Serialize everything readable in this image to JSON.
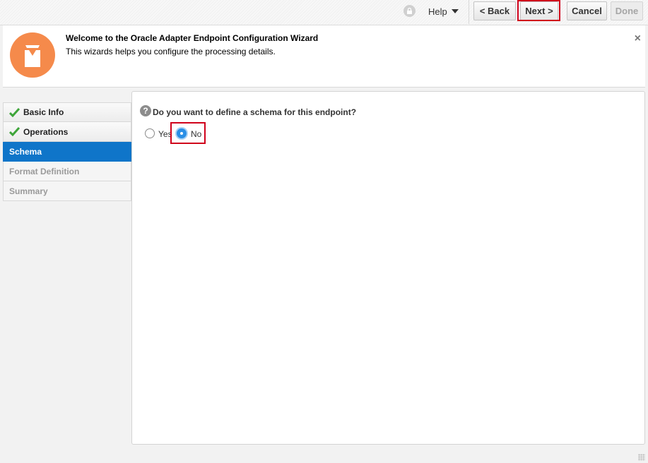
{
  "toolbar": {
    "help_label": "Help",
    "back_label": "< Back",
    "next_label": "Next >",
    "cancel_label": "Cancel",
    "done_label": "Done"
  },
  "welcome": {
    "title": "Welcome to the Oracle Adapter Endpoint Configuration Wizard",
    "subtitle": "This wizards helps you configure the processing details.",
    "close_label": "×",
    "logo_color": "#f58a4b"
  },
  "steps": [
    {
      "label": "Basic Info",
      "state": "complete"
    },
    {
      "label": "Operations",
      "state": "complete"
    },
    {
      "label": "Schema",
      "state": "active"
    },
    {
      "label": "Format Definition",
      "state": "pending"
    },
    {
      "label": "Summary",
      "state": "pending"
    }
  ],
  "main": {
    "question": "Do you want to define a schema for this endpoint?",
    "help_icon": "?",
    "options": [
      {
        "label": "Yes",
        "selected": false
      },
      {
        "label": "No",
        "selected": true
      }
    ]
  },
  "colors": {
    "accent": "#0f75c9",
    "highlight": "#d0021b",
    "check": "#3ea53a"
  }
}
